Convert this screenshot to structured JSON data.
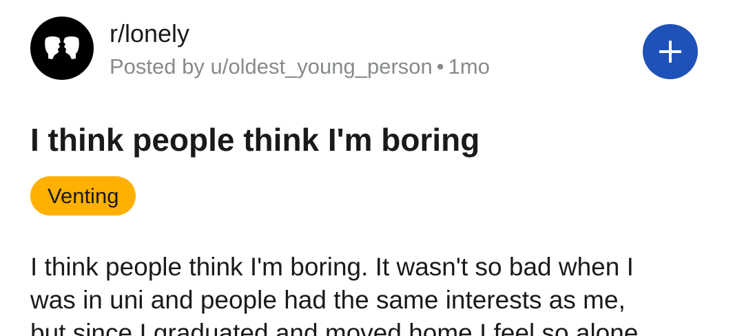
{
  "post": {
    "community": "r/lonely",
    "posted_by": "Posted by u/oldest_young_person",
    "separator": "•",
    "age": "1mo",
    "title": "I think people think I'm boring",
    "flair": "Venting",
    "body_lines": [
      "I think people think I'm boring. It wasn't so bad when I",
      "was in uni and people had the same interests as me,",
      "but since I graduated and moved home I feel so alone"
    ]
  },
  "icons": {
    "avatar": "two-faces-icon",
    "join": "plus-icon"
  },
  "colors": {
    "join_button": "#1f52b8",
    "flair_background": "#ffb000",
    "meta_text": "#878a8c",
    "avatar_background": "#000000"
  }
}
